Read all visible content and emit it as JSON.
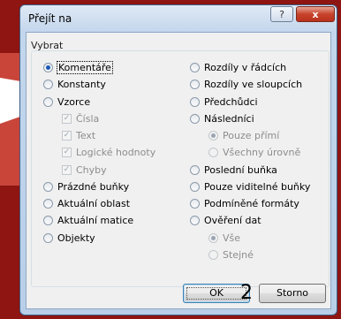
{
  "window": {
    "title": "Přejít na",
    "help_label": "?",
    "close_label": "x"
  },
  "group": {
    "label": "Vybrat",
    "left_options": [
      {
        "label": "Komentáře",
        "checked": true
      },
      {
        "label": "Konstanty"
      },
      {
        "label": "Vzorce"
      },
      {
        "label": "Prázdné buňky"
      },
      {
        "label": "Aktuální oblast"
      },
      {
        "label": "Aktuální matice"
      },
      {
        "label": "Objekty"
      }
    ],
    "formula_checks": [
      "Čísla",
      "Text",
      "Logické hodnoty",
      "Chyby"
    ],
    "right_options": [
      {
        "label": "Rozdíly v řádcích"
      },
      {
        "label": "Rozdíly ve sloupcích"
      },
      {
        "label": "Předchůdci"
      },
      {
        "label": "Následníci"
      },
      {
        "label": "Poslední buňka"
      },
      {
        "label": "Pouze viditelné buňky"
      },
      {
        "label": "Podmíněné formáty"
      },
      {
        "label": "Ověření dat"
      }
    ],
    "dependents_sub": [
      "Pouze přímí",
      "Všechny úrovně"
    ],
    "validation_sub": [
      "Vše",
      "Stejné"
    ]
  },
  "buttons": {
    "ok": "OK",
    "cancel": "Storno"
  },
  "overlay_text": "2"
}
